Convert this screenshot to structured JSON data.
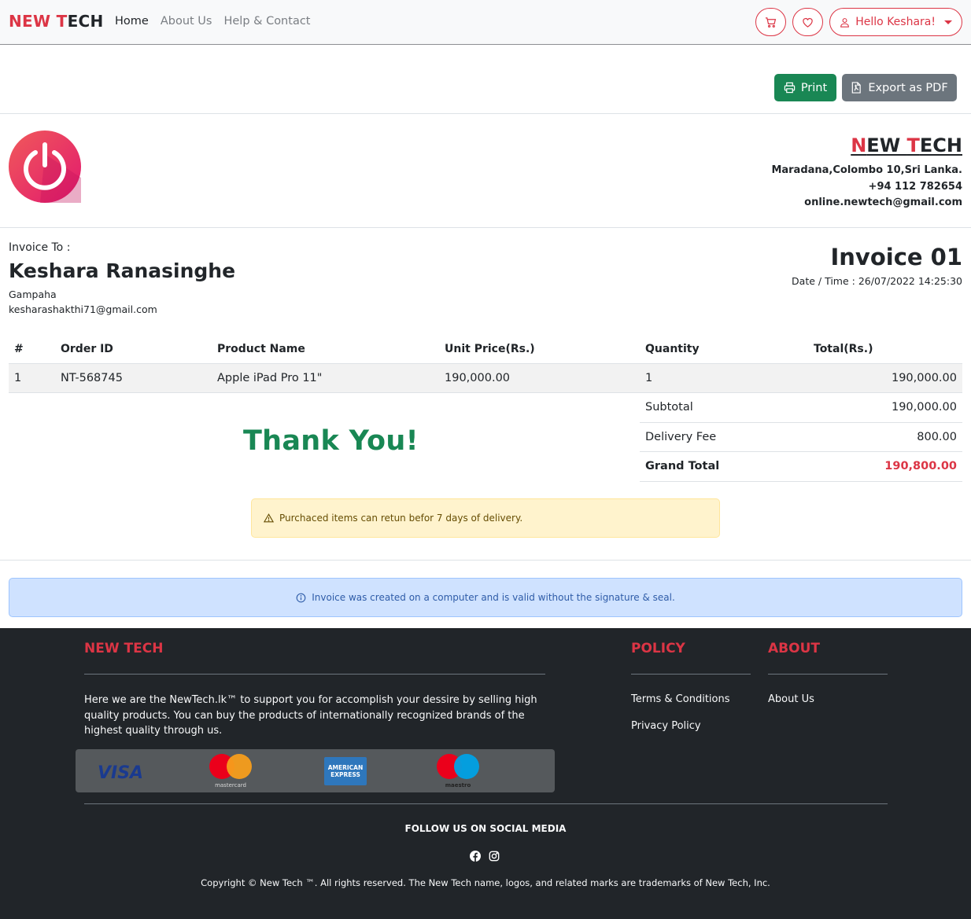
{
  "nav": {
    "brand_part1": "NEW ",
    "brand_part2": "T",
    "brand_part3": "ECH",
    "links": [
      "Home",
      "About Us",
      "Help & Contact"
    ],
    "user_label": "Hello Keshara!"
  },
  "actions": {
    "print_label": "Print",
    "pdf_label": "Export as PDF"
  },
  "company": {
    "name_part1": "N",
    "name_part2": "EW ",
    "name_part3": "T",
    "name_part4": "ECH",
    "address": "Maradana,Colombo 10,Sri Lanka.",
    "phone": "+94 112 782654",
    "email": "online.newtech@gmail.com"
  },
  "invoice": {
    "to_label": "Invoice To :",
    "customer_name": "Keshara Ranasinghe",
    "customer_city": "Gampaha",
    "customer_email": "kesharashakthi71@gmail.com",
    "title": "Invoice 01",
    "date_time": "Date / Time : 26/07/2022 14:25:30"
  },
  "table": {
    "headers": [
      "#",
      "Order ID",
      "Product Name",
      "Unit Price(Rs.)",
      "Quantity",
      "Total(Rs.)"
    ],
    "rows": [
      [
        "1",
        "NT-568745",
        "Apple iPad Pro 11\"",
        "190,000.00",
        "1",
        "190,000.00"
      ]
    ]
  },
  "totals": {
    "subtotal_label": "Subtotal",
    "subtotal_value": "190,000.00",
    "delivery_label": "Delivery Fee",
    "delivery_value": "800.00",
    "grand_label": "Grand Total",
    "grand_value": "190,800.00"
  },
  "thank_you": "Thank You!",
  "warning": "Purchaced items can retun befor 7 days of delivery.",
  "info": "Invoice was created on a computer and is valid without the signature & seal.",
  "footer": {
    "brand_heading": "NEW TECH",
    "policy_heading": "POLICY",
    "about_heading": "ABOUT",
    "description": "Here we are the NewTech.lk™ to support you for accomplish your dessire by selling high quality products. You can buy the products of internationally recognized brands of the highest quality through us.",
    "policy_links": [
      "Terms & Conditions",
      "Privacy Policy"
    ],
    "about_links": [
      "About Us"
    ],
    "payment": {
      "visa": "VISA",
      "mastercard": "mastercard",
      "amex_line1": "AMERICAN",
      "amex_line2": "EXPRESS",
      "maestro": "maestro"
    },
    "follow_label": "FOLLOW US ON SOCIAL MEDIA",
    "copyright": "Copyright © New Tech ™. All rights reserved. The New Tech name, logos, and related marks are trademarks of New Tech, Inc."
  },
  "colors": {
    "brand_red": "#dc3545",
    "success_green": "#198754",
    "secondary_gray": "#6c757d",
    "footer_bg": "#212529",
    "warning_bg": "#fff3cd",
    "info_bg": "#cfe2ff"
  }
}
